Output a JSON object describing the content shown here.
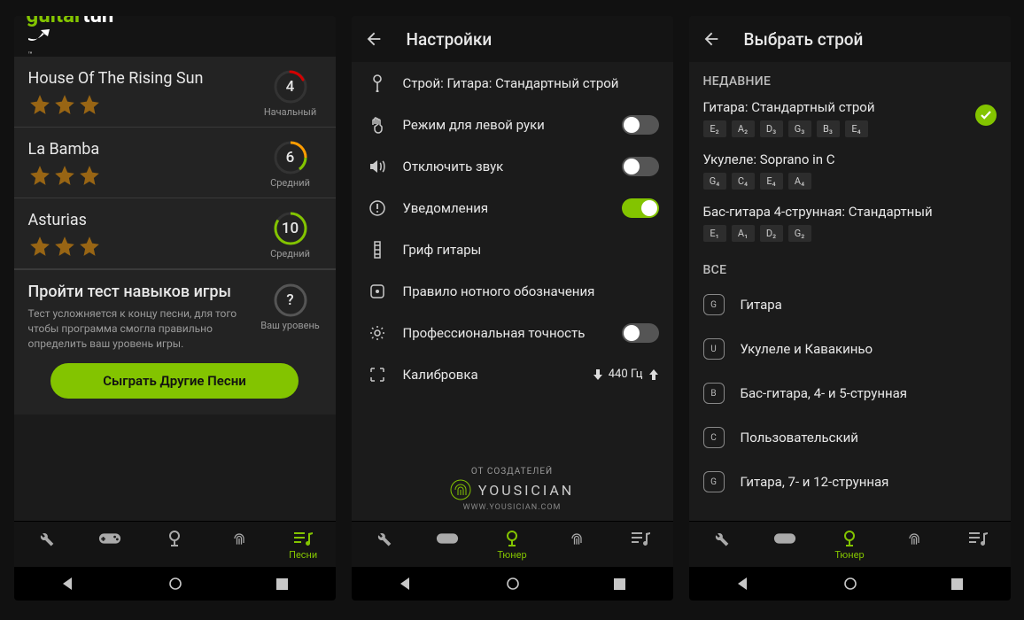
{
  "logo": {
    "text1": "guitar",
    "text2": "tun"
  },
  "songs": {
    "items": [
      {
        "title": "House Of The Rising Sun",
        "chords": "4",
        "level": "Начальный",
        "arc": "beg"
      },
      {
        "title": "La Bamba",
        "chords": "6",
        "level": "Средний",
        "arc": "mid"
      },
      {
        "title": "Asturias",
        "chords": "10",
        "level": "Средний",
        "arc": "hi"
      }
    ],
    "skill": {
      "title": "Пройти тест навыков игры",
      "desc": "Тест усложняется к концу песни, для того чтобы программа смогла правильно определить ваш уровень игры.",
      "badge": "?",
      "badge_label": "Ваш уровень"
    },
    "play_button": "Сыграть Другие Песни",
    "tab_label": "Песни"
  },
  "settings": {
    "title": "Настройки",
    "rows": {
      "tuning": "Строй: Гитара: Стандартный строй",
      "left": "Режим для левой руки",
      "mute": "Отключить звук",
      "notif": "Уведомления",
      "neck": "Гриф гитары",
      "notation": "Правило нотного обозначения",
      "pro": "Профессиональная точность",
      "calib": "Калибровка",
      "calib_val": "440 Гц"
    },
    "made_by": "ОТ СОЗДАТЕЛЕЙ",
    "brand": "YOUSICIAN",
    "url": "WWW.YOUSICIAN.COM",
    "tab_label": "Тюнер"
  },
  "tuning": {
    "title": "Выбрать строй",
    "recent_h": "НЕДАВНИЕ",
    "all_h": "ВСЕ",
    "recent": [
      {
        "name": "Гитара: Стандартный строй",
        "notes": [
          "E₂",
          "A₂",
          "D₃",
          "G₃",
          "B₃",
          "E₄"
        ],
        "selected": true
      },
      {
        "name": "Укулеле: Soprano in C",
        "notes": [
          "G₄",
          "C₄",
          "E₄",
          "A₄"
        ],
        "selected": false
      },
      {
        "name": "Бас-гитара 4-струнная: Стандартный",
        "notes": [
          "E₁",
          "A₁",
          "D₂",
          "G₂"
        ],
        "selected": false
      }
    ],
    "cats": [
      {
        "b": "G",
        "name": "Гитара"
      },
      {
        "b": "U",
        "name": "Укулеле и Кавакиньо"
      },
      {
        "b": "B",
        "name": "Бас-гитара, 4- и 5-струнная"
      },
      {
        "b": "C",
        "name": "Пользовательский"
      },
      {
        "b": "G",
        "name": "Гитара, 7- и 12-струнная"
      }
    ],
    "tab_label": "Тюнер"
  }
}
